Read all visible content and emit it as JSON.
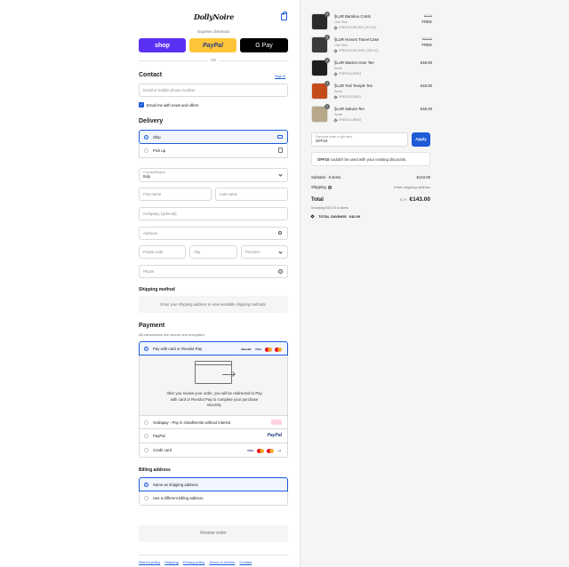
{
  "header": {
    "logo_text": "DollyNoire",
    "cart_icon": "shopping-bag-icon"
  },
  "express": {
    "label": "Express checkout",
    "buttons": [
      {
        "label": "shop",
        "color": "#5a31f4"
      },
      {
        "label": "PayPal",
        "color": "#ffc439"
      },
      {
        "label": "G Pay",
        "color": "#000000"
      }
    ],
    "or_label": "OR"
  },
  "contact": {
    "title": "Contact",
    "sign_in": "Sign in",
    "email_placeholder": "Email or mobile phone number",
    "newsletter_label": "Email me with news and offers"
  },
  "delivery": {
    "title": "Delivery",
    "options": [
      {
        "label": "Ship",
        "icon": "truck-icon"
      },
      {
        "label": "Pick up",
        "icon": "store-icon"
      }
    ],
    "country_label": "Country/Region",
    "country_value": "Italy",
    "first_name": "First name",
    "last_name": "Last name",
    "company": "Company (optional)",
    "address": "Address",
    "postal_code": "Postal code",
    "city": "City",
    "province": "Province",
    "phone": "Phone"
  },
  "shipping_method": {
    "title": "Shipping method",
    "notice": "Enter your shipping address to view available shipping methods."
  },
  "payment": {
    "title": "Payment",
    "subtitle": "All transactions are secure and encrypted.",
    "options": [
      {
        "label": "Pay with card or Revolut Pay"
      },
      {
        "label": "Scalapay - Pay in installments without interest"
      },
      {
        "label": "PayPal"
      },
      {
        "label": "Credit card"
      }
    ],
    "revolut_badge": "Revolut",
    "visa": "VISA",
    "paypal_logo": "PayPal",
    "more_cards": "+4",
    "redirect_text": "After you review your order, you will be redirected to Pay with card or Revolut Pay to complete your purchase securely."
  },
  "billing": {
    "title": "Billing address",
    "options": [
      {
        "label": "Same as shipping address"
      },
      {
        "label": "Use a different billing address"
      }
    ]
  },
  "review_button": "Review order",
  "footer_links": [
    "Refund policy",
    "Shipping",
    "Privacy policy",
    "Terms of service",
    "Contact"
  ],
  "summary": {
    "items": [
      {
        "qty": "1",
        "name": "§LUR Bamboo Comb",
        "variant": "One Size",
        "discount": "FREESLURO903 (-€7.00)",
        "old_price": "€7.00",
        "price": "FREE",
        "thumb": "#2b2b2b"
      },
      {
        "qty": "1",
        "name": "§LUR Honors Travel Case",
        "variant": "One Size",
        "discount": "FREESLURCASE (-€35.00)",
        "old_price": "€35.00",
        "price": "FREE",
        "thumb": "#3a3a3a"
      },
      {
        "qty": "1",
        "name": "§LUR Warrior Over Tee",
        "variant": "Small",
        "discount": "FREESLUR003",
        "old_price": "",
        "price": "€48.00",
        "thumb": "#1f1f1f"
      },
      {
        "qty": "1",
        "name": "§LUR Torii Temple Tee",
        "variant": "Small",
        "discount": "FREESLUR003",
        "old_price": "",
        "price": "€48.00",
        "thumb": "#c44a1c"
      },
      {
        "qty": "1",
        "name": "§LUR Sakura Tee",
        "variant": "Small",
        "discount": "FREESLUR003",
        "old_price": "",
        "price": "€45.00",
        "thumb": "#b8a88a"
      }
    ],
    "discount_label": "Discount code or gift card",
    "discount_value": "OFF10",
    "apply": "Apply",
    "error_code": "OFF10",
    "error_text": " couldn't be used with your existing discounts.",
    "subtotal_label": "Subtotal · 5 items",
    "subtotal_value": "€143.00",
    "shipping_label": "Shipping",
    "shipping_value": "Enter shipping address",
    "total_label": "Total",
    "currency": "EUR",
    "total_value": "€143.00",
    "taxes": "Including €25.78 in taxes",
    "savings_label": "TOTAL SAVINGS",
    "savings_value": "€42.00"
  }
}
